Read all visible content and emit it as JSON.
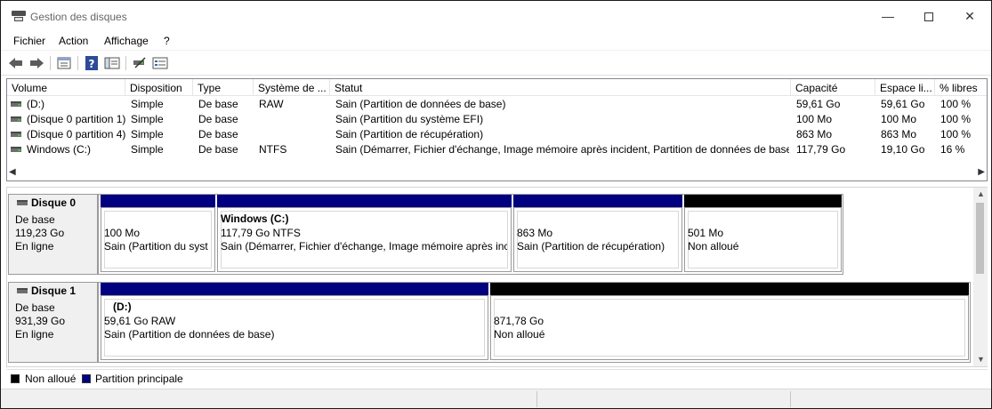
{
  "window": {
    "title": "Gestion des disques",
    "min_glyph": "—",
    "close_glyph": "✕"
  },
  "menu": [
    "Fichier",
    "Action",
    "Affichage",
    "?"
  ],
  "toolbar": [
    "back-icon",
    "forward-icon",
    "properties-icon",
    "help-icon",
    "console-tree-icon",
    "connect-icon",
    "settings-icon"
  ],
  "columns": [
    "Volume",
    "Disposition",
    "Type",
    "Système de ...",
    "Statut",
    "Capacité",
    "Espace li...",
    "% libres"
  ],
  "volumes": [
    {
      "name": "(D:)",
      "layout": "Simple",
      "type": "De base",
      "fs": "RAW",
      "status": "Sain (Partition de données de base)",
      "capacity": "59,61 Go",
      "free": "59,61 Go",
      "pct": "100 %"
    },
    {
      "name": "(Disque 0 partition 1)",
      "layout": "Simple",
      "type": "De base",
      "fs": "",
      "status": "Sain (Partition du système EFI)",
      "capacity": "100 Mo",
      "free": "100 Mo",
      "pct": "100 %"
    },
    {
      "name": "(Disque 0 partition 4)",
      "layout": "Simple",
      "type": "De base",
      "fs": "",
      "status": "Sain (Partition de récupération)",
      "capacity": "863 Mo",
      "free": "863 Mo",
      "pct": "100 %"
    },
    {
      "name": "Windows (C:)",
      "layout": "Simple",
      "type": "De base",
      "fs": "NTFS",
      "status": "Sain (Démarrer, Fichier d'échange, Image mémoire après incident, Partition de données de base)",
      "capacity": "117,79 Go",
      "free": "19,10 Go",
      "pct": "16 %"
    }
  ],
  "scroll": {
    "left": "◀",
    "right": "▶",
    "up": "▲",
    "down": "▼"
  },
  "disks": [
    {
      "name": "Disque 0",
      "kind": "De base",
      "size": "119,23 Go",
      "state": "En ligne",
      "partitions": [
        {
          "title": "",
          "line1": "100 Mo",
          "line2": "Sain (Partition du syst",
          "color": "#000080"
        },
        {
          "title": "Windows  (C:)",
          "line1": "117,79 Go NTFS",
          "line2": "Sain (Démarrer, Fichier d'échange, Image mémoire après inc",
          "color": "#000080"
        },
        {
          "title": "",
          "line1": "863 Mo",
          "line2": "Sain (Partition de récupération)",
          "color": "#000080"
        },
        {
          "title": "",
          "line1": "501 Mo",
          "line2": "Non alloué",
          "color": "#000000"
        }
      ]
    },
    {
      "name": "Disque 1",
      "kind": "De base",
      "size": "931,39 Go",
      "state": "En ligne",
      "partitions": [
        {
          "title": "(D:)",
          "line1": "59,61 Go RAW",
          "line2": "Sain (Partition de données de base)",
          "color": "#000080"
        },
        {
          "title": "",
          "line1": "871,78 Go",
          "line2": "Non alloué",
          "color": "#000000"
        }
      ]
    }
  ],
  "legend": [
    {
      "label": "Non alloué",
      "color": "#000000"
    },
    {
      "label": "Partition principale",
      "color": "#000080"
    }
  ]
}
